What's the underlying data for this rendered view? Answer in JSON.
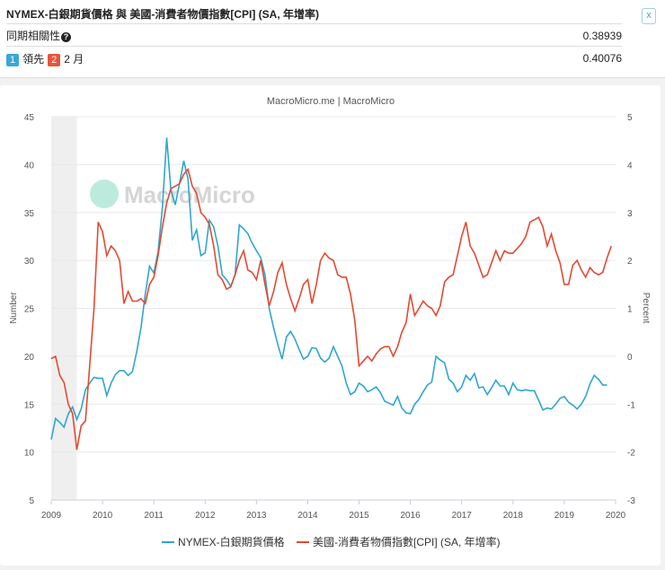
{
  "header": {
    "title": "NYMEX-白銀期貨價格 與 美國-消費者物價指數[CPI] (SA, 年增率)",
    "close_label": "x",
    "correlation_label": "同期相關性",
    "correlation_help": "?",
    "correlation_value": "0.38939",
    "lead_badge1": "1",
    "lead_text": "領先",
    "lead_badge2": "2",
    "lead_months": "2 月",
    "lead_value": "0.40076"
  },
  "colors": {
    "silver": "#2fa6cf",
    "cpi": "#e24a32",
    "badge1": "#3aa7d8",
    "badge2": "#e6553c"
  },
  "chart_data": {
    "type": "line",
    "title": "MacroMicro.me | MacroMicro",
    "watermark": "MacroMicro",
    "ylabel": "Number",
    "y2label": "Percent",
    "ylim": [
      5,
      45
    ],
    "y2lim": [
      -3,
      5
    ],
    "yticks": [
      "5",
      "10",
      "15",
      "20",
      "25",
      "30",
      "35",
      "40",
      "45"
    ],
    "y2ticks": [
      "-3",
      "-2",
      "-1",
      "0",
      "1",
      "2",
      "3",
      "4",
      "5"
    ],
    "xticks": [
      "2009",
      "2010",
      "2011",
      "2012",
      "2013",
      "2014",
      "2015",
      "2016",
      "2017",
      "2018",
      "2019",
      "2020"
    ],
    "xlim": [
      2009,
      2020
    ],
    "recession": [
      2009.0,
      2009.5
    ],
    "start": 2009.0,
    "step_months": 1,
    "series": [
      {
        "name": "NYMEX-白銀期貨價格",
        "axis": "left",
        "values": [
          11.3,
          13.5,
          13.1,
          12.6,
          14.0,
          14.7,
          13.4,
          14.5,
          16.5,
          17.2,
          17.8,
          17.7,
          17.7,
          15.9,
          17.2,
          18.1,
          18.5,
          18.5,
          18.0,
          18.4,
          20.5,
          23.0,
          26.5,
          29.4,
          28.7,
          30.9,
          35.5,
          42.8,
          37.3,
          35.8,
          38.0,
          40.4,
          38.5,
          32.1,
          33.2,
          30.5,
          30.8,
          34.2,
          33.5,
          31.5,
          28.5,
          28.0,
          27.3,
          28.5,
          33.7,
          33.3,
          32.8,
          31.8,
          31.0,
          30.3,
          28.5,
          25.0,
          23.0,
          21.2,
          19.7,
          22.0,
          22.6,
          21.8,
          20.7,
          19.7,
          20.0,
          20.9,
          20.8,
          19.8,
          19.4,
          19.8,
          21.0,
          20.0,
          19.0,
          17.2,
          16.0,
          16.3,
          17.2,
          16.9,
          16.3,
          16.5,
          16.8,
          16.2,
          15.3,
          15.1,
          14.9,
          15.8,
          14.6,
          14.1,
          14.0,
          15.0,
          15.5,
          16.3,
          17.0,
          17.3,
          20.0,
          19.6,
          19.3,
          17.6,
          17.2,
          16.3,
          16.8,
          18.0,
          17.5,
          18.2,
          16.7,
          16.8,
          16.0,
          16.7,
          17.5,
          16.9,
          16.9,
          16.0,
          17.2,
          16.5,
          16.4,
          16.5,
          16.4,
          16.4,
          15.4,
          14.4,
          14.6,
          14.5,
          15.0,
          15.6,
          15.8,
          15.2,
          14.9,
          14.5,
          15.0,
          15.8,
          17.1,
          18.0,
          17.6,
          17.0,
          17.0
        ]
      },
      {
        "name": "美國-消費者物價指數[CPI] (SA, 年增率)",
        "axis": "right",
        "values": [
          -0.05,
          0.0,
          -0.4,
          -0.55,
          -1.0,
          -1.2,
          -1.95,
          -1.45,
          -1.35,
          -0.2,
          1.0,
          2.8,
          2.6,
          2.1,
          2.3,
          2.2,
          2.0,
          1.1,
          1.35,
          1.15,
          1.15,
          1.2,
          1.1,
          1.5,
          1.65,
          2.1,
          2.7,
          3.2,
          3.5,
          3.55,
          3.6,
          3.8,
          3.9,
          3.55,
          3.4,
          3.0,
          2.9,
          2.75,
          2.3,
          1.7,
          1.6,
          1.4,
          1.45,
          1.7,
          2.0,
          2.2,
          1.8,
          1.75,
          1.6,
          2.0,
          1.5,
          1.05,
          1.35,
          1.75,
          1.95,
          1.5,
          1.2,
          0.95,
          1.2,
          1.5,
          1.6,
          1.1,
          1.5,
          2.0,
          2.15,
          2.05,
          2.0,
          1.7,
          1.65,
          1.65,
          1.3,
          0.75,
          -0.2,
          -0.1,
          0.0,
          -0.1,
          0.05,
          0.15,
          0.2,
          0.2,
          0.0,
          0.2,
          0.5,
          0.7,
          1.3,
          0.85,
          1.0,
          1.15,
          1.05,
          1.0,
          0.85,
          1.05,
          1.55,
          1.65,
          1.7,
          2.1,
          2.5,
          2.8,
          2.3,
          2.15,
          1.9,
          1.65,
          1.7,
          1.95,
          2.2,
          2.0,
          2.2,
          2.15,
          2.15,
          2.25,
          2.35,
          2.5,
          2.8,
          2.85,
          2.9,
          2.7,
          2.3,
          2.55,
          2.2,
          1.95,
          1.5,
          1.5,
          1.9,
          2.0,
          1.8,
          1.65,
          1.85,
          1.75,
          1.7,
          1.75,
          2.05,
          2.3
        ]
      }
    ],
    "legend": "bottom"
  }
}
